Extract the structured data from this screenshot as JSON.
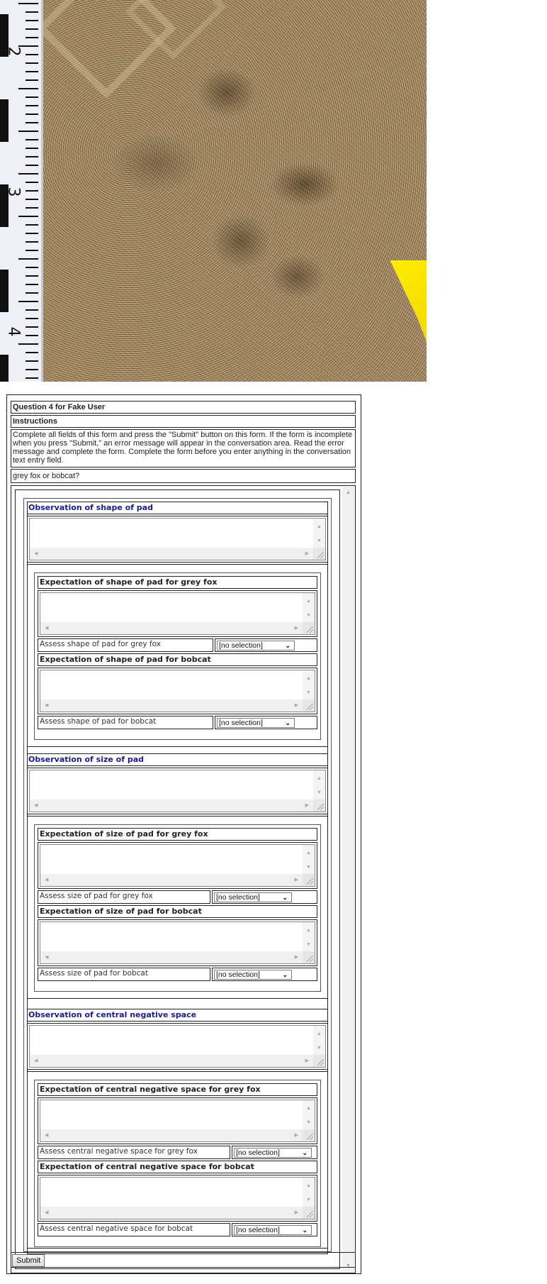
{
  "photo": {
    "description": "animal track in sand with scale ruler",
    "ruler_marks": [
      "2",
      "3",
      "4"
    ]
  },
  "form": {
    "title": "Question 4 for Fake User",
    "instructions_heading": "Instructions",
    "instructions_text": "Complete all fields of this form and press the \"Submit\" button on this form. If the form is incomplete when you press \"Submit,\" an error message will appear in the conversation area. Read the error message and complete the form. Complete the form before you enter anything in the conversation text entry field.",
    "question": "grey fox or bobcat?",
    "sections": [
      {
        "observation_title": "Observation of shape of pad",
        "observation_value": "",
        "expectations": [
          {
            "title": "Expectation of shape of pad for grey fox",
            "value": "",
            "assess_label": "Assess shape of pad for grey fox",
            "assess_value": "[no selection]"
          },
          {
            "title": "Expectation of shape of pad for bobcat",
            "value": "",
            "assess_label": "Assess shape of pad for bobcat",
            "assess_value": "[no selection]"
          }
        ]
      },
      {
        "observation_title": "Observation of size of pad",
        "observation_value": "",
        "expectations": [
          {
            "title": "Expectation of size of pad for grey fox",
            "value": "",
            "assess_label": "Assess size of pad for grey fox",
            "assess_value": "[no selection]"
          },
          {
            "title": "Expectation of size of pad for bobcat",
            "value": "",
            "assess_label": "Assess size of pad for bobcat",
            "assess_value": "[no selection]"
          }
        ]
      },
      {
        "observation_title": "Observation of central negative space",
        "observation_value": "",
        "expectations": [
          {
            "title": "Expectation of central negative space for grey fox",
            "value": "",
            "assess_label": "Assess central negative space for grey fox",
            "assess_value": "[no selection]"
          },
          {
            "title": "Expectation of central negative space for bobcat",
            "value": "",
            "assess_label": "Assess central negative space for bobcat",
            "assess_value": "[no selection]"
          }
        ]
      }
    ],
    "submit_label": "Submit"
  },
  "icons": {
    "scroll_up": "▲",
    "scroll_down": "▼",
    "scroll_left": "◀",
    "scroll_right": "▶",
    "dropdown": "⌄"
  }
}
